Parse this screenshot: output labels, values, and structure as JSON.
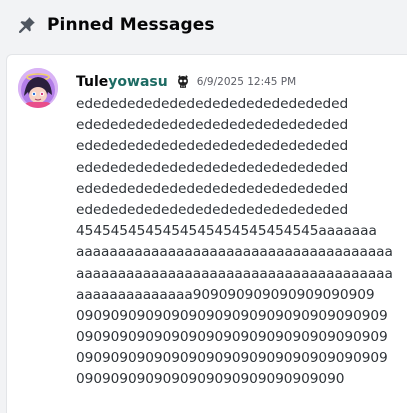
{
  "header": {
    "title": "Pinned Messages",
    "icon": "pin-icon"
  },
  "message": {
    "author_prefix": "Tule",
    "author_accent": "yowasu",
    "timestamp": "6/9/2025 12:45 PM",
    "avatar_icon": "avatar",
    "badge_icon": "skull-badge-icon",
    "lines": [
      "edededededededededededededededed",
      "edededededededededededededededed",
      "edededededededededededededededed",
      "edededededededededededededededed",
      "edededededededededededededededed",
      "edededededededededededededededed",
      "4545454545454545454545454545aaaaaaa",
      "aaaaaaaaaaaaaaaaaaaaaaaaaaaaaaaaaaaaaa",
      "aaaaaaaaaaaaaaaaaaaaaaaaaaaaaaaaaaaaaa",
      "aaaaaaaaaaaaaa909090909090909090909",
      "090909090909090909090909090909090909",
      "090909090909090909090909090909090909",
      "090909090909090909090909090909090909",
      "0909090909090909090909090909090"
    ]
  },
  "colors": {
    "background": "#f2f3f5",
    "card": "#ffffff",
    "text": "#2e3338",
    "author_accent": "#1d6b63"
  }
}
